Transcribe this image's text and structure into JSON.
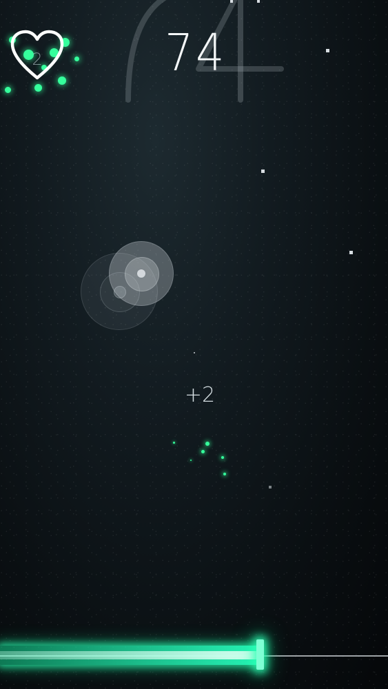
{
  "hud": {
    "score": "74",
    "lives": "2",
    "bonus": "+2",
    "progress": 0.67
  },
  "icons": {
    "heart": "heart-icon",
    "target": "target-icon"
  },
  "colors": {
    "background": "#0a0f12",
    "accent": "#35ff9c",
    "text": "#f4f7f8",
    "muted": "#d4dde1"
  }
}
